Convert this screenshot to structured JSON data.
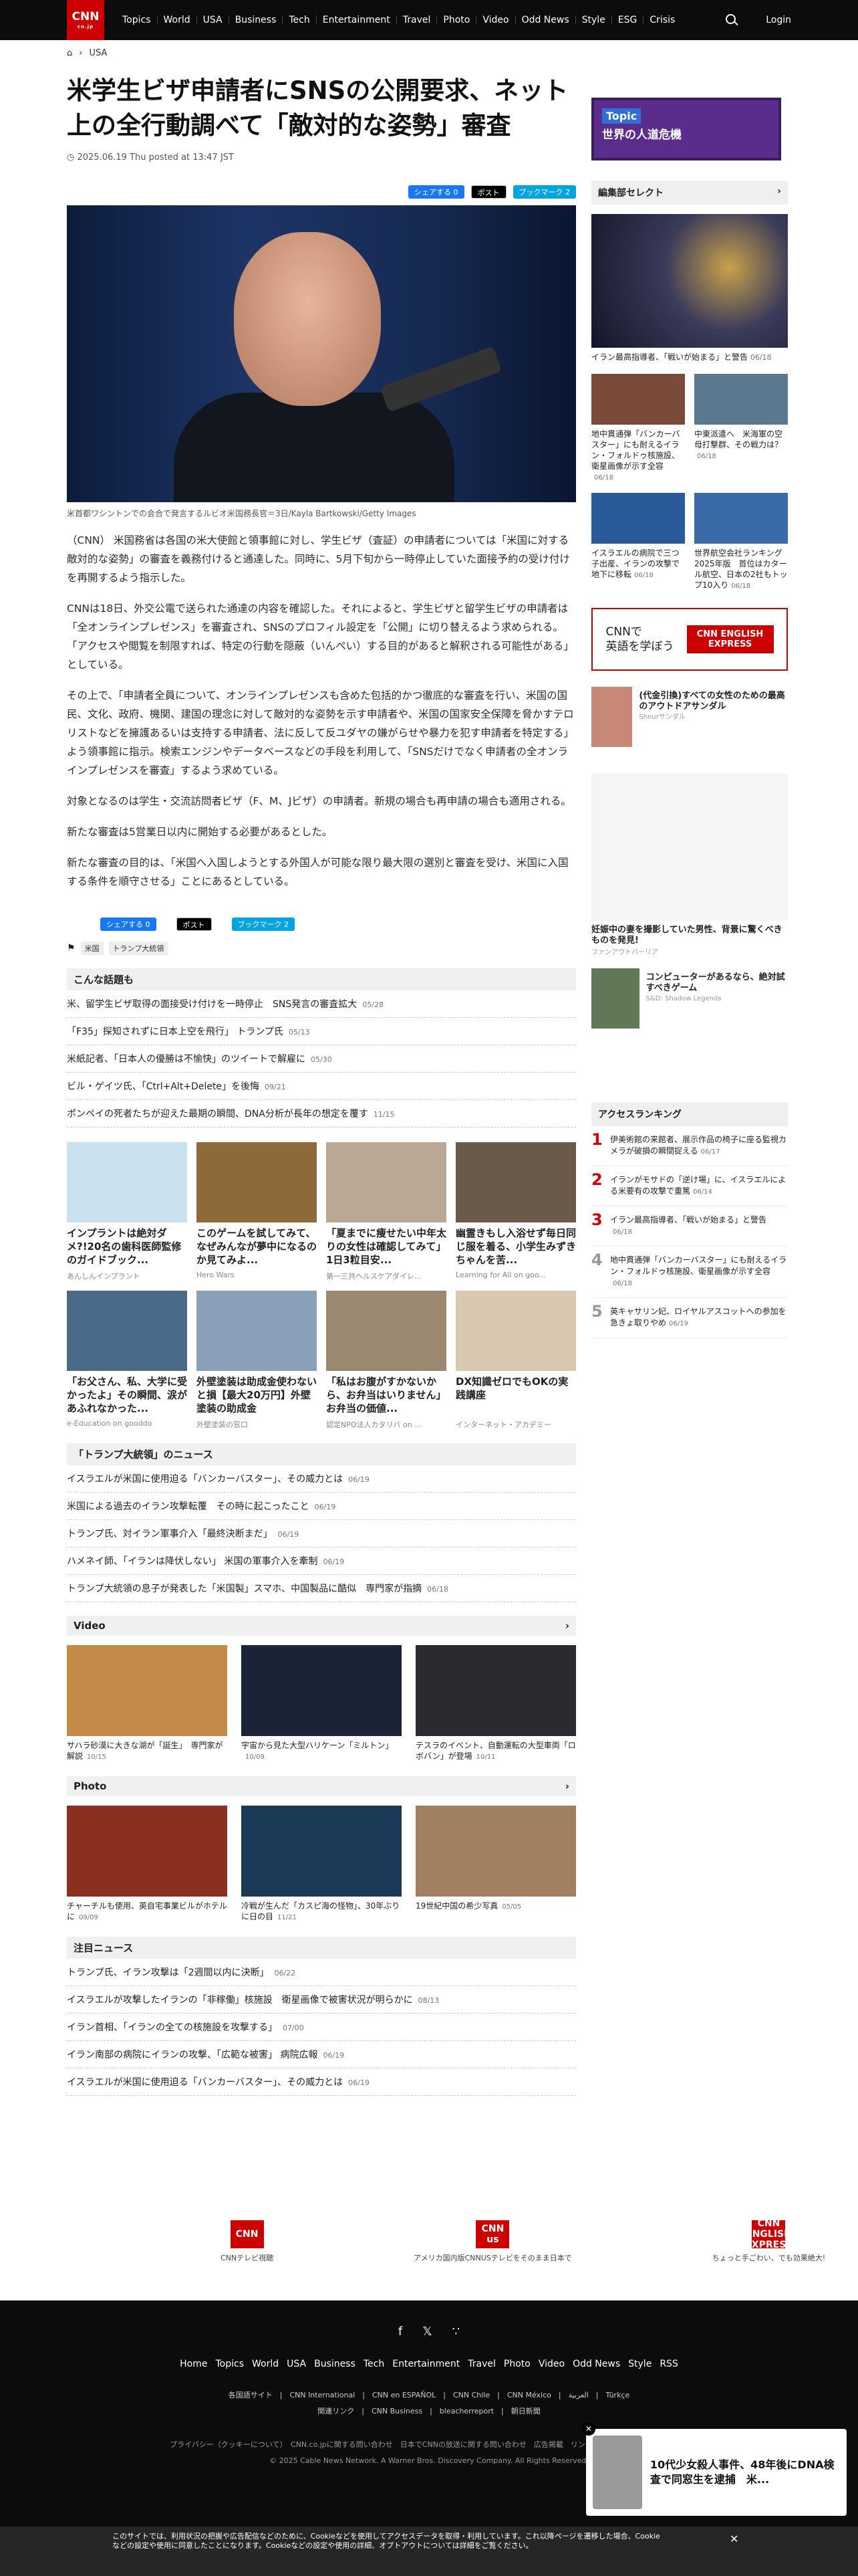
{
  "nav": {
    "logo": "CNN",
    "logo_sub": "co.jp",
    "items": [
      "Topics",
      "World",
      "USA",
      "Business",
      "Tech",
      "Entertainment",
      "Travel",
      "Photo",
      "Video",
      "Odd News",
      "Style",
      "ESG",
      "Crisis"
    ],
    "login": "Login"
  },
  "breadcrumb": "USA",
  "article": {
    "title": "米学生ビザ申請者にSNSの公開要求、ネット上の全行動調べて「敵対的な姿勢」審査",
    "date": "2025.06.19 Thu posted at 13:47 JST",
    "share": {
      "fb": "シェアする 0",
      "x": "ポスト",
      "hb": "ブックマーク 2"
    },
    "caption": "米首都ワシントンでの会合で発言するルビオ米国務長官＝3日/Kayla Bartkowski/Getty Images",
    "paragraphs": [
      "（CNN） 米国務省は各国の米大使館と領事館に対し、学生ビザ（査証）の申請者については「米国に対する敵対的な姿勢」の審査を義務付けると通達した。同時に、5月下旬から一時停止していた面接予約の受け付けを再開するよう指示した。",
      "CNNは18日、外交公電で送られた通達の内容を確認した。それによると、学生ビザと留学生ビザの申請者は「全オンラインプレゼンス」を審査され、SNSのプロフィル設定を「公開」に切り替えるよう求められる。「アクセスや閲覧を制限すれば、特定の行動を隠蔽（いんぺい）する目的があると解釈される可能性がある」としている。",
      "その上で、「申請者全員について、オンラインプレゼンスも含めた包括的かつ徹底的な審査を行い、米国の国民、文化、政府、機関、建国の理念に対して敵対的な姿勢を示す申請者や、米国の国家安全保障を脅かすテロリストなどを擁護あるいは支持する申請者、法に反して反ユダヤの嫌がらせや暴力を犯す申請者を特定する」よう領事館に指示。検索エンジンやデータベースなどの手段を利用して、「SNSだけでなく申請者の全オンラインプレゼンスを審査」するよう求めている。",
      "対象となるのは学生・交流訪問者ビザ（F、M、Jビザ）の申請者。新規の場合も再申請の場合も適用される。",
      "新たな審査は5営業日以内に開始する必要があるとした。",
      "新たな審査の目的は、「米国へ入国しようとする外国人が可能な限り最大限の選別と審査を受け、米国に入国する条件を順守させる」ことにあるとしている。"
    ],
    "share2": {
      "fb": "シェアする 0",
      "x": "ポスト",
      "hb": "ブックマーク 2"
    },
    "tags": [
      "米国",
      "トランプ大統領"
    ]
  },
  "related": {
    "heading": "こんな話題も",
    "items": [
      {
        "t": "米、留学生ビザ取得の面接受け付けを一時停止　SNS発言の審査拡大",
        "d": "05/28"
      },
      {
        "t": "「F35」探知されずに日本上空を飛行」 トランプ氏",
        "d": "05/13"
      },
      {
        "t": "米紙記者、「日本人の優勝は不愉快」のツイートで解雇に",
        "d": "05/30"
      },
      {
        "t": "ビル・ゲイツ氏、「Ctrl+Alt+Delete」を後悔",
        "d": "09/21"
      },
      {
        "t": "ポンペイの死者たちが迎えた最期の瞬間、DNA分析が長年の想定を覆す",
        "d": "11/15"
      }
    ]
  },
  "ads": [
    {
      "t": "インプラントは絶対ダメ?!20名の歯科医師監修のガイドブック...",
      "s": "あんしんインプラント",
      "c": "#c9e2ee"
    },
    {
      "t": "このゲームを試してみて、なぜみんなが夢中になるのか見てみよ...",
      "s": "Hero Wars",
      "c": "#8c6a3a"
    },
    {
      "t": "「夏までに痩せたい中年太りの女性は確認してみて」1日3粒目安...",
      "s": "第一三共ヘルスケアダイレ...",
      "c": "#b8a894"
    },
    {
      "t": "幽霊きもし入浴せず毎日同じ服を着る、小学生みずきちゃんを苦...",
      "s": "Learning for All on goo...",
      "c": "#6a5a4a"
    },
    {
      "t": "「お父さん、私、大学に受かったよ」その瞬間、涙があふれなかった...",
      "s": "e-Education on gooddo",
      "c": "#4a6a8a"
    },
    {
      "t": "外壁塗装は助成金使わないと損【最大20万円】外壁塗装の助成金",
      "s": "外壁塗装の窓口",
      "c": "#8aa0b8"
    },
    {
      "t": "「私はお腹がすかないから、お弁当はいりません」お弁当の価値...",
      "s": "認定NPO法人カタリバ on ...",
      "c": "#9a8870"
    },
    {
      "t": "DX知識ゼロでもOKの実践講座",
      "s": "インターネット・アカデミー",
      "c": "#d8c8b0"
    }
  ],
  "trump": {
    "heading": "「トランプ大統領」のニュース",
    "items": [
      {
        "t": "イスラエルが米国に使用迫る「バンカーバスター」、その威力とは",
        "d": "06/19"
      },
      {
        "t": "米国による過去のイラン攻撃転覆　その時に起こったこと",
        "d": "06/19"
      },
      {
        "t": "トランプ氏、対イラン軍事介入「最終決断まだ」",
        "d": "06/19"
      },
      {
        "t": "ハメネイ師、「イランは降伏しない」 米国の軍事介入を牽制",
        "d": "06/19"
      },
      {
        "t": "トランプ大統領の息子が発表した「米国製」スマホ、中国製品に酷似　専門家が指摘",
        "d": "06/18"
      }
    ]
  },
  "video": {
    "heading": "Video",
    "items": [
      {
        "t": "サハラ砂漠に大きな湖が「誕生」　専門家が解説",
        "d": "10/15",
        "c": "#c48a4a"
      },
      {
        "t": "宇宙から見た大型ハリケーン「ミルトン」",
        "d": "10/09",
        "c": "#1a2436"
      },
      {
        "t": "テスラのイベント、自動運転の大型車両「ロボバン」が登場",
        "d": "10/11",
        "c": "#2a2a30"
      }
    ]
  },
  "photo": {
    "heading": "Photo",
    "items": [
      {
        "t": "チャーチルも使用、英自宅事業ビルがホテルに",
        "d": "09/09",
        "c": "#8a3020"
      },
      {
        "t": "冷戦が生んだ「カスピ海の怪物」、30年ぶりに日の目",
        "d": "11/21",
        "c": "#1a3a58"
      },
      {
        "t": "19世紀中国の希少写真",
        "d": "05/05",
        "c": "#a08060"
      }
    ]
  },
  "attention": {
    "heading": "注目ニュース",
    "items": [
      {
        "t": "トランプ氏、イラン攻撃は「2週間以内に決断」",
        "d": "06/22"
      },
      {
        "t": "イスラエルが攻撃したイランの「非稼働」核施設　衛星画像で被害状況が明らかに",
        "d": "08/13"
      },
      {
        "t": "イラン首相、「イランの全ての核施設を攻撃する」",
        "d": "07/00"
      },
      {
        "t": "イラン南部の病院にイランの攻撃、「広範な被害」 病院広報",
        "d": "06/19"
      },
      {
        "t": "イスラエルが米国に使用迫る「バンカーバスター」、その威力とは",
        "d": "06/19"
      }
    ]
  },
  "sidebar": {
    "topic": {
      "label": "Topic",
      "title": "世界の人道危機"
    },
    "editor_heading": "編集部セレクト",
    "main_story": {
      "t": "イラン最高指導者、「戦いが始まる」と警告",
      "d": "06/18"
    },
    "grid": [
      {
        "t": "地中貫通弾「バンカーバスター」にも耐えるイラン・フォルドゥ核施設、衛星画像が示す全容",
        "d": "06/18",
        "c": "#7a4a3a"
      },
      {
        "t": "中東派遣へ　米海軍の空母打撃群、その戦力は？",
        "d": "06/18",
        "c": "#5a7890"
      },
      {
        "t": "イスラエルの病院で三つ子出産、イランの攻撃で地下に移転",
        "d": "06/18",
        "c": "#2a5a9a"
      },
      {
        "t": "世界航空会社ランキング2025年版　首位はカタール航空、日本の2社もトップ10入り",
        "d": "06/18",
        "c": "#3a6aa8"
      }
    ],
    "lesson": {
      "t1": "CNNで",
      "t2": "英語を学ぼう",
      "brand": "CNN ENGLISH EXPRESS"
    },
    "ad1": {
      "t": "(代金引換)すべての女性のための最高のアウトドアサンダル",
      "s": "Shnurサンダル"
    },
    "ad2": {
      "t": "妊娠中の妻を撮影していた男性、背景に驚くべきものを発見!",
      "s": "ファンアウトバーリア"
    },
    "ad3": {
      "t": "コンピューターがあるなら、絶対試すべきゲーム",
      "s": "S&D: Shadow Legends"
    },
    "ranking_heading": "アクセスランキング",
    "ranking": [
      {
        "n": "1",
        "t": "伊美術館の来館者、展示作品の椅子に座る監視カメラが破損の瞬間捉える",
        "d": "06/17"
      },
      {
        "n": "2",
        "t": "イランがモサドの「逆け場」に、イスラエルによる米要有の攻撃で重篤",
        "d": "06/14"
      },
      {
        "n": "3",
        "t": "イラン最高指導者、「戦いが始まる」と警告",
        "d": "06/18"
      },
      {
        "n": "4",
        "t": "地中貫通弾「バンカーバスター」にも耐えるイラン・フォルドゥ核施設、衛星画像が示す全容",
        "d": "06/18"
      },
      {
        "n": "5",
        "t": "英キャサリン妃、ロイヤルアスコットへの参加を急きょ取りやめ",
        "d": "06/19"
      }
    ]
  },
  "partners": [
    {
      "name": "CNN",
      "t": "CNNテレビ視聴"
    },
    {
      "name": "CNN us",
      "t": "アメリカ国内版CNNUSテレビをそのまま日本で"
    },
    {
      "name": "CNN ENGLISH EXPRESS",
      "t": "ちょっと手ごわい、でも効果絶大!"
    }
  ],
  "footer": {
    "nav": [
      "Home",
      "Topics",
      "World",
      "USA",
      "Business",
      "Tech",
      "Entertainment",
      "Travel",
      "Photo",
      "Video",
      "Odd News",
      "Style",
      "RSS"
    ],
    "links": "各国語サイト　|　CNN International　|　CNN en ESPAÑOL　|　CNN Chile　|　CNN México　|　العربية　|　Türkçe",
    "links2": "関連リンク　|　CNN Business　|　bleacherreport　|　朝日新聞",
    "legal": "プライバシー（クッキーについて）　CNN.co.jpに関する問い合わせ　日本でCNNの放送に関する問い合わせ　広告掲載　リンク　ご利用規約　サイトマップ",
    "copyright": "© 2025 Cable News Network. A Warner Bros. Discovery Company. All Rights Reserved."
  },
  "popup": {
    "t": "10代少女殺人事件、48年後にDNA検査で同窓生を逮捕　米..."
  },
  "cookie": {
    "text": "このサイトでは、利用状況の把握や広告配信などのために、Cookieなどを使用してアクセスデータを取得・利用しています。これ以降ページを遷移した場合、Cookieなどの設定や使用に同意したことになります。Cookieなどの設定や使用の詳細、オプトアウトについては詳細をご覧ください。"
  }
}
